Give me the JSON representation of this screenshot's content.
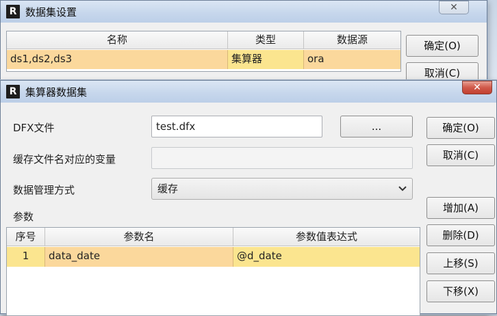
{
  "outer_dialog": {
    "title": "数据集设置",
    "table": {
      "headers": [
        "名称",
        "类型",
        "数据源"
      ],
      "rows": [
        {
          "name": "ds1,ds2,ds3",
          "type": "集算器",
          "source": "ora"
        }
      ]
    },
    "ok_label": "确定(O)",
    "cancel_label": "取消(C)"
  },
  "inner_dialog": {
    "title": "集算器数据集",
    "close_glyph": "✕",
    "dfx_label": "DFX文件",
    "dfx_value": "test.dfx",
    "browse_label": "...",
    "cache_var_label": "缓存文件名对应的变量",
    "cache_var_value": "",
    "manage_label": "数据管理方式",
    "manage_value": "缓存",
    "params_label": "参数",
    "params_table": {
      "headers": [
        "序号",
        "参数名",
        "参数值表达式"
      ],
      "rows": [
        {
          "index": "1",
          "name": "data_date",
          "expr": "@d_date"
        }
      ]
    },
    "ok_label": "确定(O)",
    "cancel_label": "取消(C)",
    "add_label": "增加(A)",
    "delete_label": "删除(D)",
    "up_label": "上移(S)",
    "down_label": "下移(X)"
  },
  "icons": {
    "app": "R",
    "dropdown": "chevron-down-icon",
    "close": "close-icon"
  },
  "colors": {
    "selected_row": "#fbd89c",
    "close_red": "#c9493a",
    "title_bar": "#c7d7ec"
  }
}
